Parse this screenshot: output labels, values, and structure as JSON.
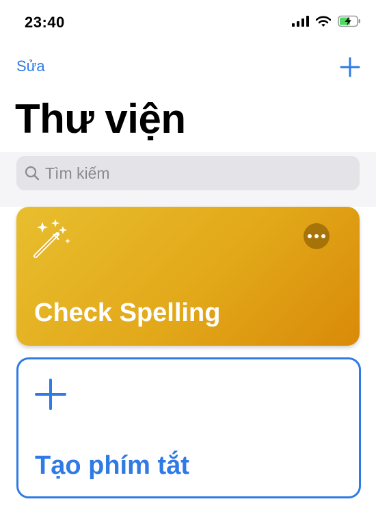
{
  "status_bar": {
    "time": "23:40"
  },
  "nav": {
    "edit_label": "Sửa"
  },
  "page": {
    "title": "Thư viện"
  },
  "search": {
    "placeholder": "Tìm kiếm"
  },
  "shortcuts": [
    {
      "title": "Check Spelling",
      "color": "#e2a81a",
      "icon": "magic-wand-icon"
    }
  ],
  "create_shortcut": {
    "label": "Tạo phím tắt"
  },
  "colors": {
    "accent": "#2f7ae5",
    "card_start": "#e8be2e",
    "card_end": "#d98a08"
  }
}
